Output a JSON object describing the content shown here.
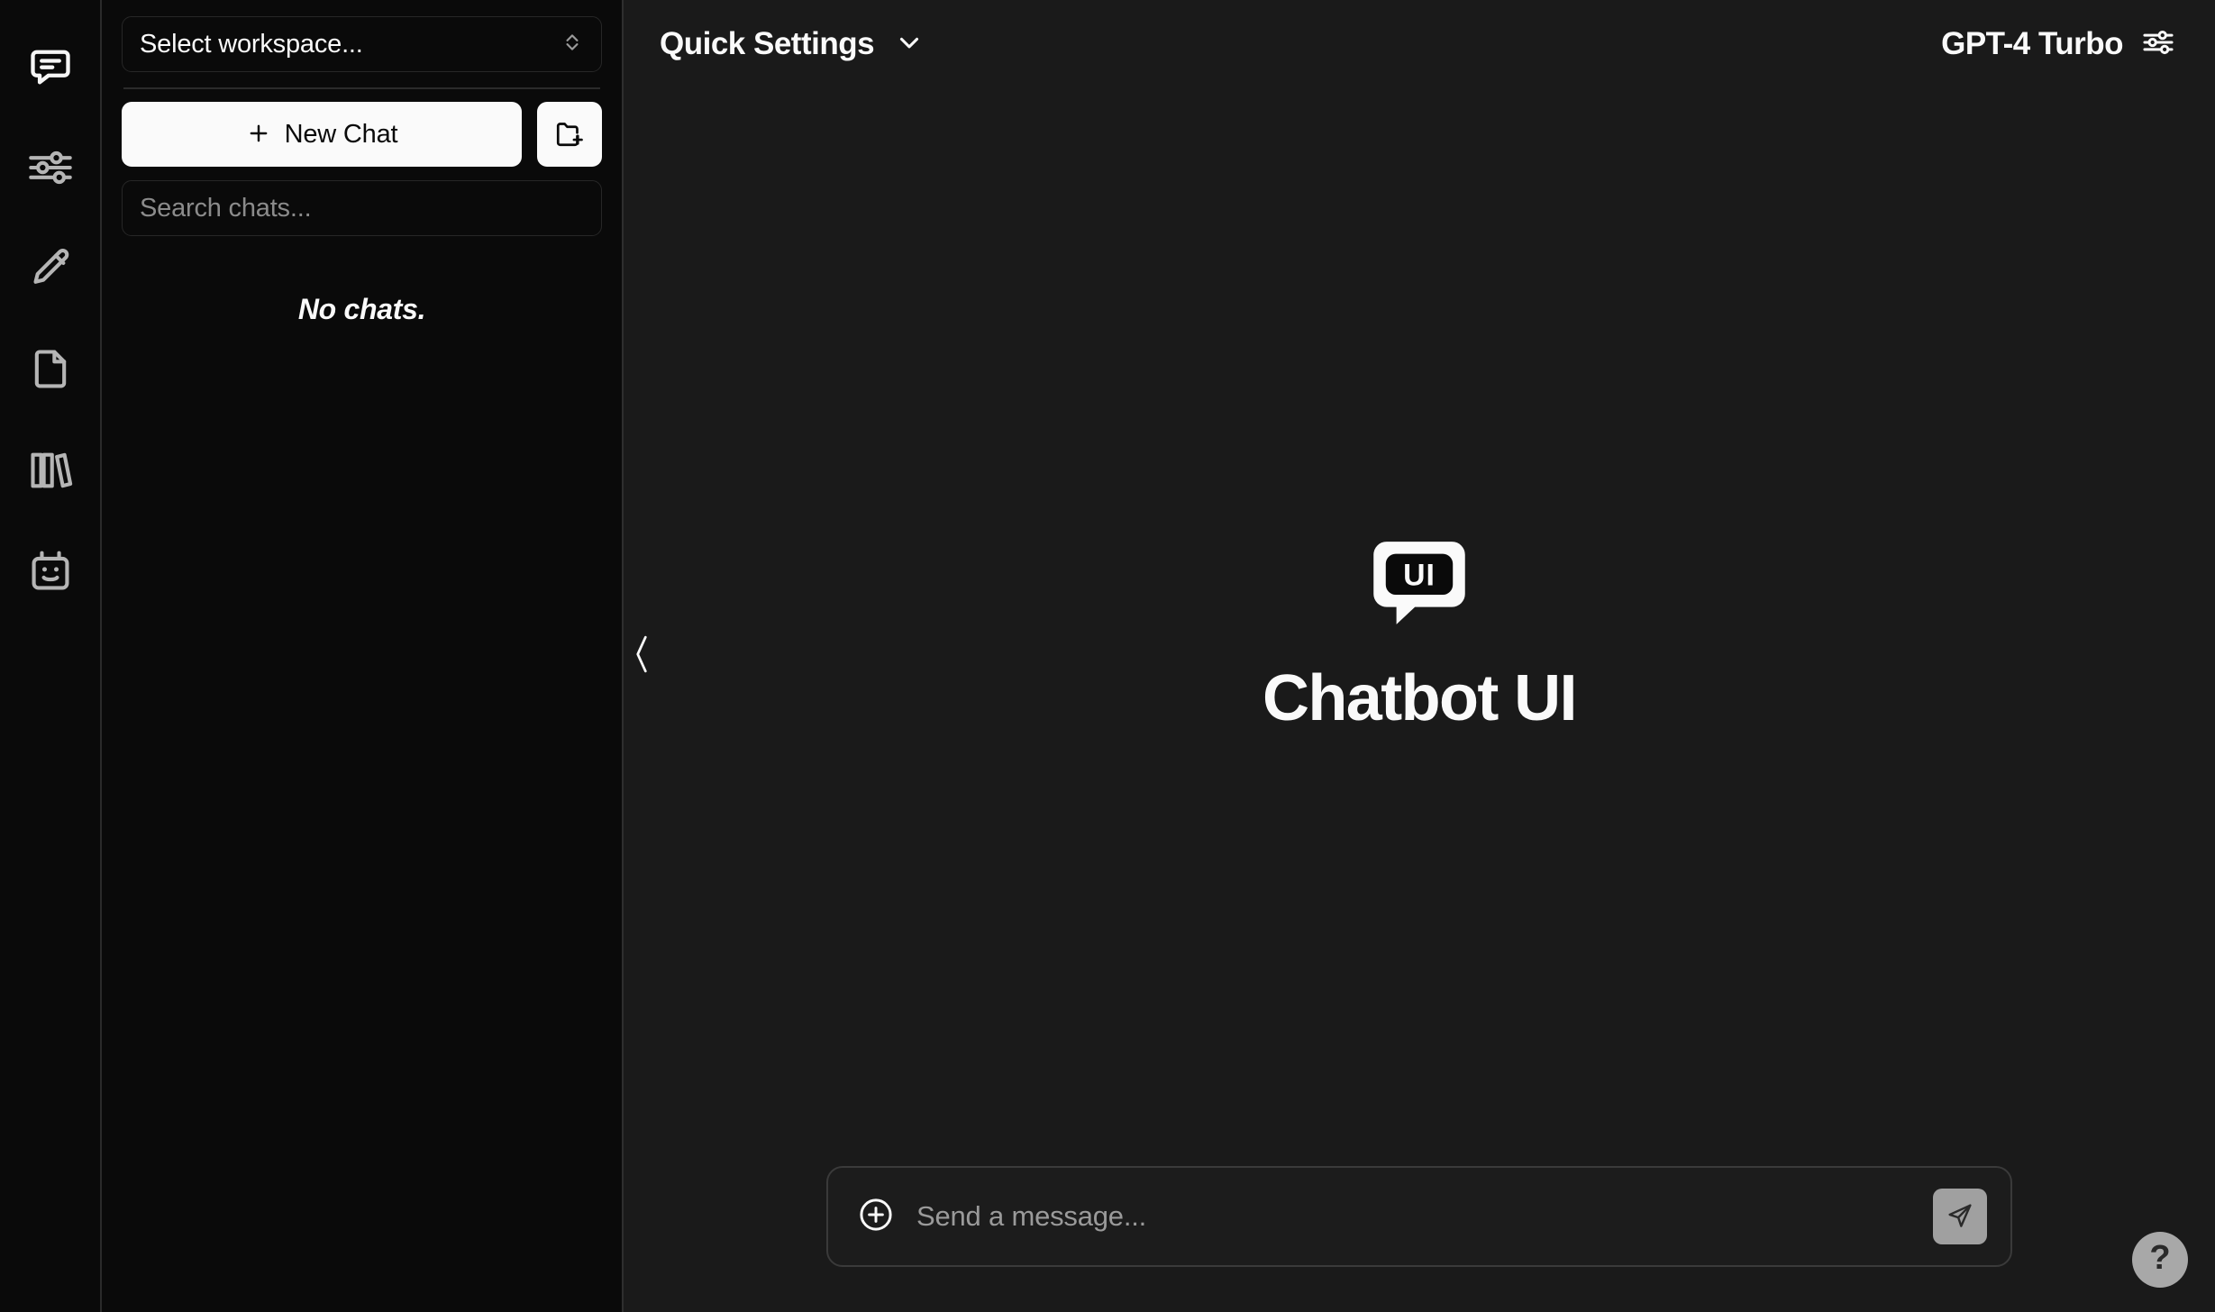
{
  "colors": {
    "rail_bg": "#0a0a0a",
    "panel_bg": "#0a0a0a",
    "main_bg": "#1a1a1a",
    "accent_light": "#fafafa",
    "muted": "#8b8b8b",
    "send_btn_bg": "#a0a0a0",
    "help_btn_bg": "#a8a8a8"
  },
  "icon_rail": {
    "items": [
      {
        "name": "chat-icon",
        "label": "Chats"
      },
      {
        "name": "sliders-icon",
        "label": "Presets"
      },
      {
        "name": "pencil-icon",
        "label": "Prompts"
      },
      {
        "name": "file-icon",
        "label": "Files"
      },
      {
        "name": "books-icon",
        "label": "Collections"
      },
      {
        "name": "robot-icon",
        "label": "Assistants"
      }
    ]
  },
  "sidebar": {
    "workspace": {
      "label": "Select workspace...",
      "chevron_icon": "chevron-up-down-icon"
    },
    "new_chat": {
      "label": "New Chat",
      "plus_icon": "plus-icon"
    },
    "new_folder": {
      "icon": "folder-plus-icon",
      "label": "New Folder"
    },
    "search": {
      "placeholder": "Search chats...",
      "value": ""
    },
    "empty_state": "No chats."
  },
  "header": {
    "quick_settings": {
      "label": "Quick Settings",
      "chevron_icon": "chevron-down-icon"
    },
    "model": {
      "label": "GPT-4 Turbo",
      "icon": "sliders-icon"
    }
  },
  "main": {
    "collapse_handle_icon": "chevron-left-icon",
    "brand": {
      "logo_text": "UI",
      "logo_icon": "chatbot-ui-logo",
      "title": "Chatbot UI"
    },
    "composer": {
      "attach_icon": "circle-plus-icon",
      "placeholder": "Send a message...",
      "value": "",
      "send_icon": "send-plane-icon"
    },
    "help_button": {
      "label": "?",
      "icon": "question-mark-icon"
    }
  }
}
